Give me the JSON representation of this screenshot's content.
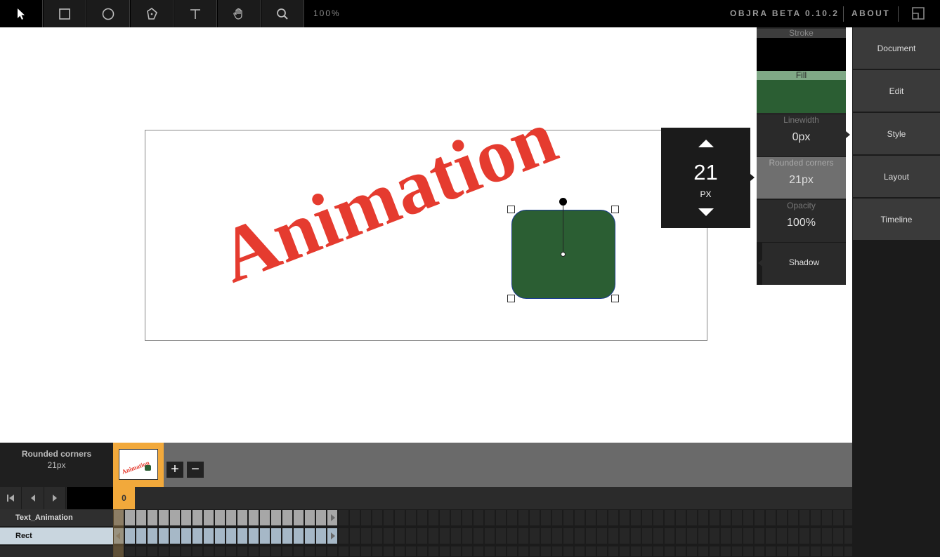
{
  "toolbar": {
    "tools": [
      {
        "name": "select-tool",
        "icon": "arrow-cursor-icon"
      },
      {
        "name": "rectangle-tool",
        "icon": "rectangle-icon"
      },
      {
        "name": "ellipse-tool",
        "icon": "circle-icon"
      },
      {
        "name": "pen-tool",
        "icon": "pen-icon"
      },
      {
        "name": "text-tool",
        "icon": "text-icon"
      },
      {
        "name": "hand-tool",
        "icon": "hand-icon"
      },
      {
        "name": "zoom-tool",
        "icon": "magnifier-icon"
      }
    ],
    "zoom": "100%",
    "app_title": "OBJRA BETA 0.10.2",
    "about": "ABOUT"
  },
  "canvas": {
    "text_object": "Animation",
    "text_color": "#e53b2f",
    "rect_fill": "#2b5e33",
    "rect_stroke": "#1b3c8e"
  },
  "stepper": {
    "value": "21",
    "unit": "PX"
  },
  "style_panel": {
    "stroke_label": "Stroke",
    "stroke_color": "#000000",
    "fill_label": "Fill",
    "fill_color": "#2b5e33",
    "linewidth_label": "Linewidth",
    "linewidth_value": "0px",
    "rounded_label": "Rounded corners",
    "rounded_value": "21px",
    "opacity_label": "Opacity",
    "opacity_value": "100%",
    "shadow_label": "Shadow"
  },
  "right_nav": {
    "items": [
      "Document",
      "Edit",
      "Style",
      "Layout",
      "Timeline"
    ]
  },
  "timeline": {
    "property_name": "Rounded corners",
    "property_value": "21px",
    "thumb_text": "Animation",
    "add_label": "+",
    "remove_label": "−",
    "current_frame": "0",
    "tracks": [
      "Text_Animation",
      "Rect"
    ]
  },
  "colors": {
    "accent_orange": "#f2a93b",
    "toolbar_bg": "#000000",
    "panel_bg": "#2a2a2a"
  }
}
